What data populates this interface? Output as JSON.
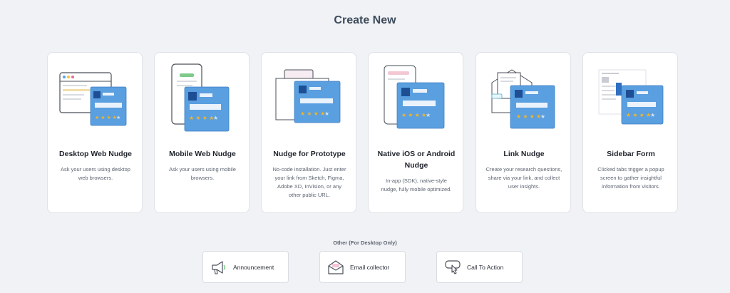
{
  "header": {
    "title": "Create New"
  },
  "colors": {
    "background": "#f1f2f6",
    "card_accent": "#5a9fe0",
    "card_dark_square": "#1e4f94",
    "star": "#f0b429",
    "green_badge": "#7fc98b"
  },
  "cards": [
    {
      "title": "Desktop Web Nudge",
      "desc_lines": [
        "Ask your users using desktop",
        "web browsers."
      ]
    },
    {
      "title": "Mobile Web Nudge",
      "desc_lines": [
        "Ask your users using mobile",
        "browsers."
      ]
    },
    {
      "title": "Nudge for Prototype",
      "desc_lines": [
        "No-code installation. Just enter",
        "your link from Sketch, Figma,",
        "Adobe XD, InVision, or any",
        "other public URL."
      ]
    },
    {
      "title_lines": [
        "Native iOS or Android",
        "Nudge"
      ],
      "desc_lines": [
        "In-app (SDK), native-style",
        "nudge, fully mobile optimized."
      ]
    },
    {
      "title": "Link Nudge",
      "desc_lines": [
        "Create your research questions,",
        "share via your link, and collect",
        "user insights."
      ]
    },
    {
      "title": "Sidebar Form",
      "desc_lines": [
        "Clicked tabs trigger a popup",
        "screen to gather insightful",
        "information from visitors."
      ]
    }
  ],
  "other": {
    "label": "Other (For Desktop Only)",
    "items": [
      {
        "label": "Announcement",
        "icon": "megaphone-icon"
      },
      {
        "label": "Email collector",
        "icon": "envelope-icon"
      },
      {
        "label": "Call To Action",
        "icon": "pointer-click-icon"
      }
    ]
  }
}
